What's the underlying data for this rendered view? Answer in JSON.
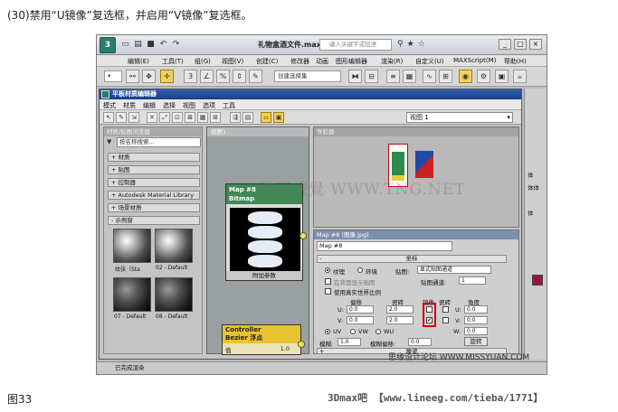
{
  "caption_top": "(30)禁用“U镜像”复选框，并启用“V镜像”复选框。",
  "caption_bottom": "图33",
  "credit": "3Dmax吧 【www.lineeg.com/tieba/1771】",
  "app": {
    "logo": "3",
    "title": "礼物盒酒文件.max",
    "search_placeholder": "键入关键字或短语",
    "menu": [
      "编辑(E)",
      "工具(T)",
      "组(G)",
      "视图(V)",
      "创建(C)",
      "修改器",
      "动画",
      "图形编辑器",
      "渲染(R)",
      "自定义(U)",
      "MAXScript(M)",
      "帮助(H)"
    ],
    "selection_set": "创建选择集",
    "status": "已完成渲染"
  },
  "slate": {
    "title": "平板材质编辑器",
    "menu": [
      "模式",
      "材质",
      "编辑",
      "选择",
      "视图",
      "选项",
      "工具"
    ],
    "view_dropdown": "视图 1"
  },
  "browser": {
    "title": "材质/贴图浏览器",
    "search": "按名称搜索...",
    "categories": [
      "+ 材质",
      "+ 贴图",
      "+ 控制器",
      "+ Autodesk Material Library",
      "+ 场景材质",
      "- 示例窗"
    ],
    "thumbs": [
      "纹张（Sta",
      "02 - Default",
      "07 - Default",
      "08 - Default"
    ]
  },
  "nodeview": {
    "tab": "视图1",
    "node_map": {
      "title_line1": "Map #8",
      "title_line2": "Bitmap",
      "footer": "附加参数"
    },
    "node_ctrl": {
      "title_line1": "Controller",
      "title_line2": "Bezier 浮点",
      "row_label": "值",
      "row_value": "1.0"
    }
  },
  "navigator": {
    "title": "导航器"
  },
  "params": {
    "title": "Map #8 (图像.jpg)",
    "map_name": "Map #8",
    "rollout_coords": "坐标",
    "texture_label": "纹理",
    "environ_label": "环境",
    "mapping_label": "贴图:",
    "mapping_value": "显式贴图通道",
    "show_on_back": "在背面显示贴图",
    "channel_label": "贴图通道:",
    "channel_value": "1",
    "real_world": "使用真实世界比例",
    "offset_header": "偏移",
    "tiling_header": "瓷砖",
    "mirror_header": "镜像",
    "tile_header": "瓷砖",
    "angle_header": "角度",
    "u_label": "U:",
    "v_label": "V:",
    "w_label": "W:",
    "u_offset": "0.0",
    "v_offset": "0.0",
    "u_tiling": "2.0",
    "v_tiling": "2.0",
    "u_angle": "0.0",
    "v_angle": "0.0",
    "w_angle": "0.0",
    "u_mirror": false,
    "v_mirror": true,
    "check_mark": "✔",
    "uv_label": "UV",
    "vw_label": "VW",
    "wu_label": "WU",
    "blur_label": "模糊:",
    "blur_value": "1.0",
    "blur_offset_label": "模糊偏移:",
    "blur_offset_value": "0.0",
    "rotate_button": "旋转",
    "rollout_noise": "噪波",
    "rollout_bitmap": "位图参数"
  },
  "side_strip": [
    "体",
    "体体",
    "",
    "体"
  ],
  "watermarks": {
    "center": "腾龍視覺 WWW.TNG.NET",
    "corner": "思缘设计论坛 WWW.MISSYUAN.COM"
  }
}
